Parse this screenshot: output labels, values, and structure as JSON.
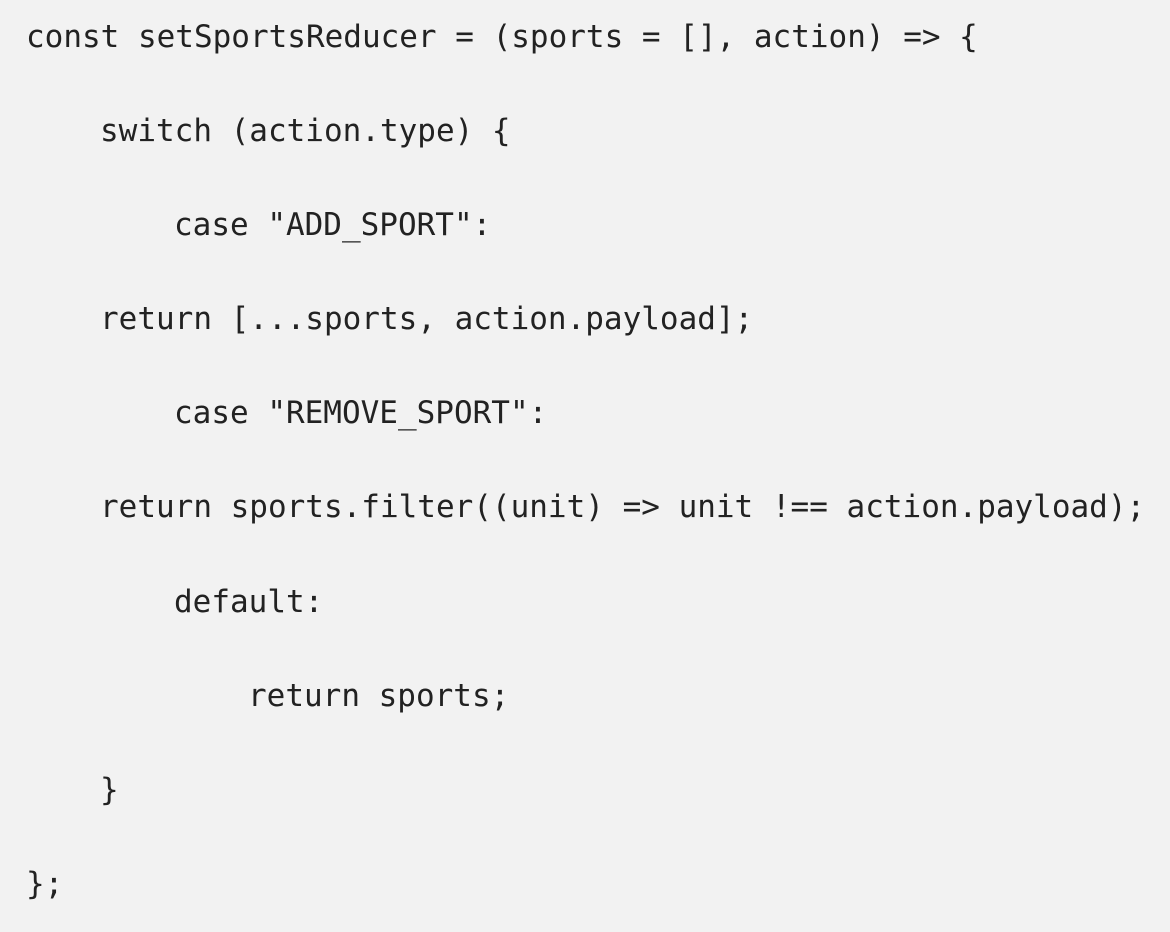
{
  "code": {
    "lines": [
      "const setSportsReducer = (sports = [], action) => {",
      "switch (action.type) {",
      "case \"ADD_SPORT\":",
      "return [...sports, action.payload];",
      "case \"REMOVE_SPORT\":",
      "return sports.filter((unit) => unit !== action.payload);",
      "default:",
      "return sports;",
      "}",
      "};"
    ]
  }
}
